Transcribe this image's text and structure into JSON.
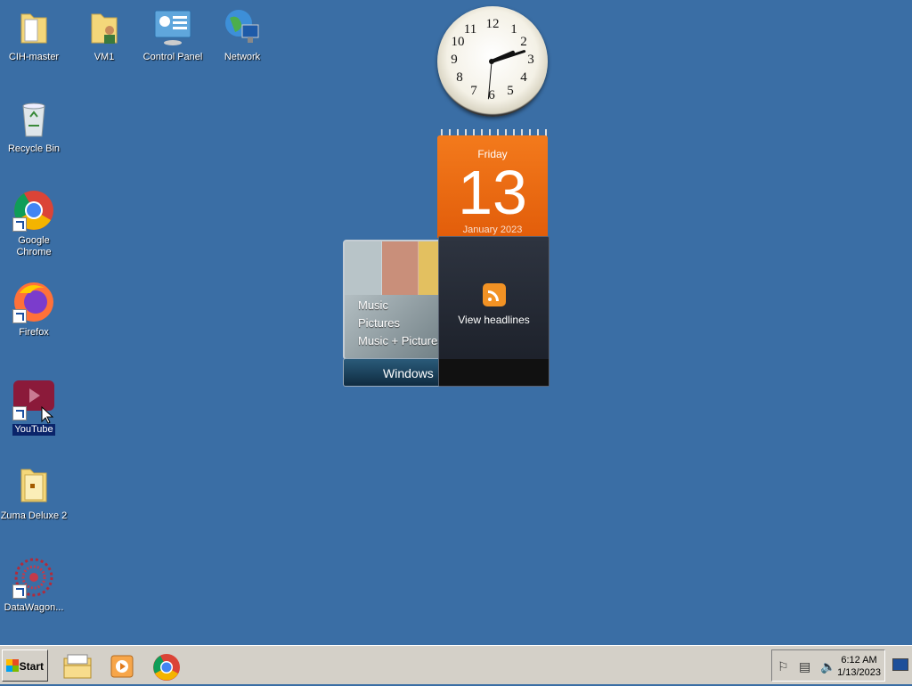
{
  "desktop": {
    "icons": [
      {
        "label": "CIH-master"
      },
      {
        "label": "VM1"
      },
      {
        "label": "Control Panel"
      },
      {
        "label": "Network"
      },
      {
        "label": "Recycle Bin"
      },
      {
        "label": "Google Chrome"
      },
      {
        "label": "Firefox"
      },
      {
        "label": "YouTube"
      },
      {
        "label": "Zuma Deluxe 2"
      },
      {
        "label": "DataWagon..."
      }
    ]
  },
  "gadgets": {
    "clock": {
      "numbers": [
        "12",
        "1",
        "2",
        "3",
        "4",
        "5",
        "6",
        "7",
        "8",
        "9",
        "10",
        "11"
      ]
    },
    "calendar": {
      "weekday": "Friday",
      "day": "13",
      "month": "January 2023"
    },
    "media": {
      "items": [
        "Music",
        "Pictures",
        "Music + Pictures"
      ],
      "bar_label": "Windows Media Center"
    },
    "feed": {
      "label": "View headlines"
    }
  },
  "taskbar": {
    "start_label": "Start",
    "time": "6:12 AM",
    "date": "1/13/2023"
  },
  "colors": {
    "desktop": "#3a6ea5",
    "calendar": "#f07016",
    "taskbar": "#d4d0c8",
    "selection": "#0a246a"
  }
}
